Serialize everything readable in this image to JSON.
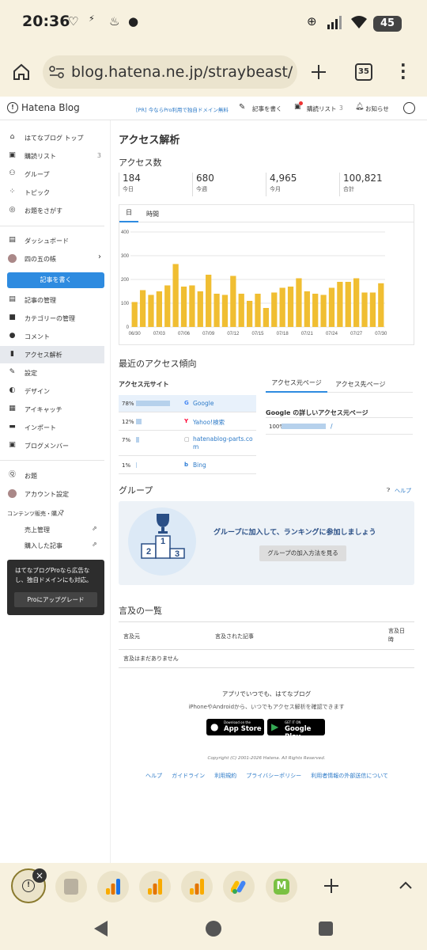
{
  "status": {
    "time": "20:36",
    "battery": "45"
  },
  "browser": {
    "url": "blog.hatena.ne.jp/straybeast/st",
    "tab_count": "35"
  },
  "header": {
    "logo": "Hatena Blog",
    "promo": "[PR] 今ならPro利用で独自ドメイン無料",
    "write": "記事を書く",
    "reading_list": "購読リスト",
    "reading_count": "3",
    "notifications": "お知らせ"
  },
  "sidebar": {
    "top_items": [
      {
        "label": "はてなブログ トップ",
        "icon": "home-icon"
      },
      {
        "label": "購読リスト",
        "icon": "bookmark-icon",
        "count": "3"
      },
      {
        "label": "グループ",
        "icon": "group-icon"
      },
      {
        "label": "トピック",
        "icon": "topic-icon"
      },
      {
        "label": "お題をさがす",
        "icon": "search-icon"
      }
    ],
    "dashboard": "ダッシュボード",
    "blog_name": "四の五の帳",
    "write_button": "記事を書く",
    "manage_items": [
      {
        "label": "記事の管理",
        "icon": "article-icon"
      },
      {
        "label": "カテゴリーの管理",
        "icon": "folder-icon"
      },
      {
        "label": "コメント",
        "icon": "comment-icon"
      },
      {
        "label": "アクセス解析",
        "icon": "chart-icon"
      },
      {
        "label": "設定",
        "icon": "wrench-icon"
      },
      {
        "label": "デザイン",
        "icon": "palette-icon"
      },
      {
        "label": "アイキャッチ",
        "icon": "image-icon"
      },
      {
        "label": "インポート",
        "icon": "import-icon"
      },
      {
        "label": "ブログメンバー",
        "icon": "members-icon"
      }
    ],
    "odai": "お題",
    "account": "アカウント設定",
    "contents_heading": "コンテンツ販売・購入",
    "sales": "売上管理",
    "purchased": "購入した記事",
    "pro_text": "はてなブログProなら広告なし、独自ドメインにも対応。",
    "pro_button": "Proにアップグレード"
  },
  "main": {
    "title": "アクセス解析",
    "access_count_heading": "アクセス数",
    "stats": [
      {
        "value": "184",
        "label": "今日"
      },
      {
        "value": "680",
        "label": "今週"
      },
      {
        "value": "4,965",
        "label": "今月"
      },
      {
        "value": "100,821",
        "label": "合計"
      }
    ],
    "tabs": [
      "日",
      "時間"
    ],
    "trend_heading": "最近のアクセス傾向",
    "source_heading": "アクセス元サイト",
    "sources": [
      {
        "pct": "78%",
        "value": 78,
        "name": "Google"
      },
      {
        "pct": "12%",
        "value": 12,
        "name": "Yahoo!検索"
      },
      {
        "pct": "7%",
        "value": 7,
        "name": "hatenablog-parts.com"
      },
      {
        "pct": "1%",
        "value": 1,
        "name": "Bing"
      }
    ],
    "page_tabs": [
      "アクセス元ページ",
      "アクセス先ページ"
    ],
    "google_heading": "Google の詳しいアクセス元ページ",
    "google_rows": [
      {
        "pct": "100%",
        "value": 100,
        "path": "/"
      }
    ],
    "group_heading": "グループ",
    "help": "ヘルプ",
    "group_cta": "グループに加入して、ランキングに参加しましょう",
    "group_button": "グループの加入方法を見る",
    "mentions_heading": "言及の一覧",
    "mention_cols": [
      "言及元",
      "言及された記事",
      "言及日時"
    ],
    "mention_empty": "言及はまだありません",
    "app_title": "アプリでいつでも、はてなブログ",
    "app_sub": "iPhoneやAndroidから、いつでもアクセス解析を確認できます",
    "appstore_small": "Download on the",
    "appstore": "App Store",
    "gplay_small": "GET IT ON",
    "gplay": "Google Play",
    "copyright": "Copyright (C) 2001-2026 Hatena. All Rights Reserved.",
    "footer_links": [
      "ヘルプ",
      "ガイドライン",
      "利用規約",
      "プライバシーポリシー",
      "利用者情報の外部送信について"
    ]
  },
  "chart_data": {
    "type": "bar",
    "categories": [
      "06/30",
      "07/01",
      "07/02",
      "07/03",
      "07/04",
      "07/05",
      "07/06",
      "07/07",
      "07/08",
      "07/09",
      "07/10",
      "07/11",
      "07/12",
      "07/13",
      "07/14",
      "07/15",
      "07/16",
      "07/17",
      "07/18",
      "07/19",
      "07/20",
      "07/21",
      "07/22",
      "07/23",
      "07/24",
      "07/25",
      "07/26",
      "07/27",
      "07/28",
      "07/29",
      "07/30"
    ],
    "values": [
      105,
      155,
      135,
      150,
      175,
      265,
      170,
      175,
      150,
      220,
      140,
      135,
      215,
      140,
      110,
      140,
      80,
      145,
      165,
      170,
      205,
      150,
      140,
      135,
      165,
      190,
      190,
      205,
      145,
      145,
      184
    ],
    "ylim": [
      0,
      400
    ],
    "yticks": [
      "0",
      "100",
      "200",
      "300",
      "400"
    ],
    "xticks": [
      "06/30",
      "07/03",
      "07/06",
      "07/09",
      "07/12",
      "07/15",
      "07/18",
      "07/21",
      "07/24",
      "07/27",
      "07/30"
    ],
    "color": "#f0be32",
    "grid": true
  }
}
